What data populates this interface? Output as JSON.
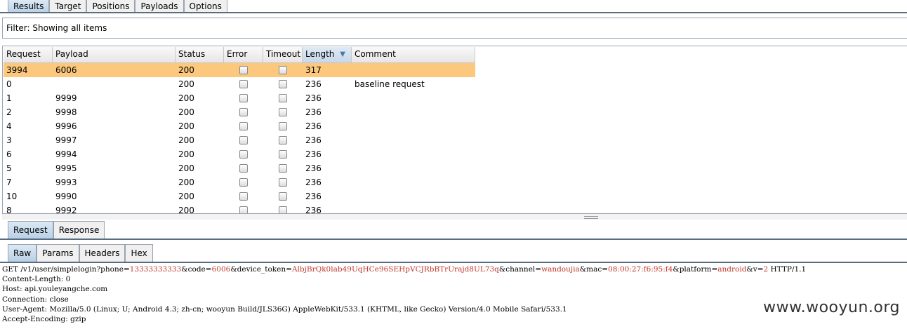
{
  "top_tabs": [
    {
      "label": "Results",
      "active": true
    },
    {
      "label": "Target",
      "active": false
    },
    {
      "label": "Positions",
      "active": false
    },
    {
      "label": "Payloads",
      "active": false
    },
    {
      "label": "Options",
      "active": false
    }
  ],
  "filter": {
    "label": "Filter: Showing all items"
  },
  "table": {
    "columns": [
      "Request",
      "Payload",
      "Status",
      "Error",
      "Timeout",
      "Length",
      "Comment"
    ],
    "sorted_column": "Length",
    "rows": [
      {
        "request": "3994",
        "payload": "6006",
        "status": "200",
        "error": false,
        "timeout": false,
        "length": "317",
        "comment": "",
        "selected": true
      },
      {
        "request": "0",
        "payload": "",
        "status": "200",
        "error": false,
        "timeout": false,
        "length": "236",
        "comment": "baseline request",
        "selected": false
      },
      {
        "request": "1",
        "payload": "9999",
        "status": "200",
        "error": false,
        "timeout": false,
        "length": "236",
        "comment": "",
        "selected": false
      },
      {
        "request": "2",
        "payload": "9998",
        "status": "200",
        "error": false,
        "timeout": false,
        "length": "236",
        "comment": "",
        "selected": false
      },
      {
        "request": "4",
        "payload": "9996",
        "status": "200",
        "error": false,
        "timeout": false,
        "length": "236",
        "comment": "",
        "selected": false
      },
      {
        "request": "3",
        "payload": "9997",
        "status": "200",
        "error": false,
        "timeout": false,
        "length": "236",
        "comment": "",
        "selected": false
      },
      {
        "request": "6",
        "payload": "9994",
        "status": "200",
        "error": false,
        "timeout": false,
        "length": "236",
        "comment": "",
        "selected": false
      },
      {
        "request": "5",
        "payload": "9995",
        "status": "200",
        "error": false,
        "timeout": false,
        "length": "236",
        "comment": "",
        "selected": false
      },
      {
        "request": "7",
        "payload": "9993",
        "status": "200",
        "error": false,
        "timeout": false,
        "length": "236",
        "comment": "",
        "selected": false
      },
      {
        "request": "10",
        "payload": "9990",
        "status": "200",
        "error": false,
        "timeout": false,
        "length": "236",
        "comment": "",
        "selected": false
      },
      {
        "request": "8",
        "payload": "9992",
        "status": "200",
        "error": false,
        "timeout": false,
        "length": "236",
        "comment": "",
        "selected": false
      }
    ]
  },
  "message_tabs": [
    {
      "label": "Request",
      "active": true
    },
    {
      "label": "Response",
      "active": false
    }
  ],
  "view_tabs": [
    {
      "label": "Raw",
      "active": true
    },
    {
      "label": "Params",
      "active": false
    },
    {
      "label": "Headers",
      "active": false
    },
    {
      "label": "Hex",
      "active": false
    }
  ],
  "request": {
    "request_line": {
      "prefix": "GET /v1/user/simplelogin?",
      "params": [
        {
          "key": "phone",
          "value": "13333333333"
        },
        {
          "key": "code",
          "value": "6006"
        },
        {
          "key": "device_token",
          "value": "AlbjBrQk0lab49UqHCe96SEHpVCJRbBTrUrajd8UL73q"
        },
        {
          "key": "channel",
          "value": "wandoujia"
        },
        {
          "key": "mac",
          "value": "08:00:27:f6:95:f4"
        },
        {
          "key": "platform",
          "value": "android"
        },
        {
          "key": "v",
          "value": "2"
        }
      ],
      "suffix": " HTTP/1.1"
    },
    "headers": [
      "Content-Length: 0",
      "Host: api.youleyangche.com",
      "Connection: close",
      "User-Agent: Mozilla/5.0 (Linux; U; Android 4.3; zh-cn; wooyun Build/JLS36G) AppleWebKit/533.1 (KHTML, like Gecko) Version/4.0 Mobile Safari/533.1",
      "Accept-Encoding: gzip"
    ]
  },
  "watermark": "www.wooyun.org",
  "colors": {
    "selected_row": "#fbc87d",
    "param_value": "#c0392b",
    "tab_active": "#c6d8ea"
  }
}
